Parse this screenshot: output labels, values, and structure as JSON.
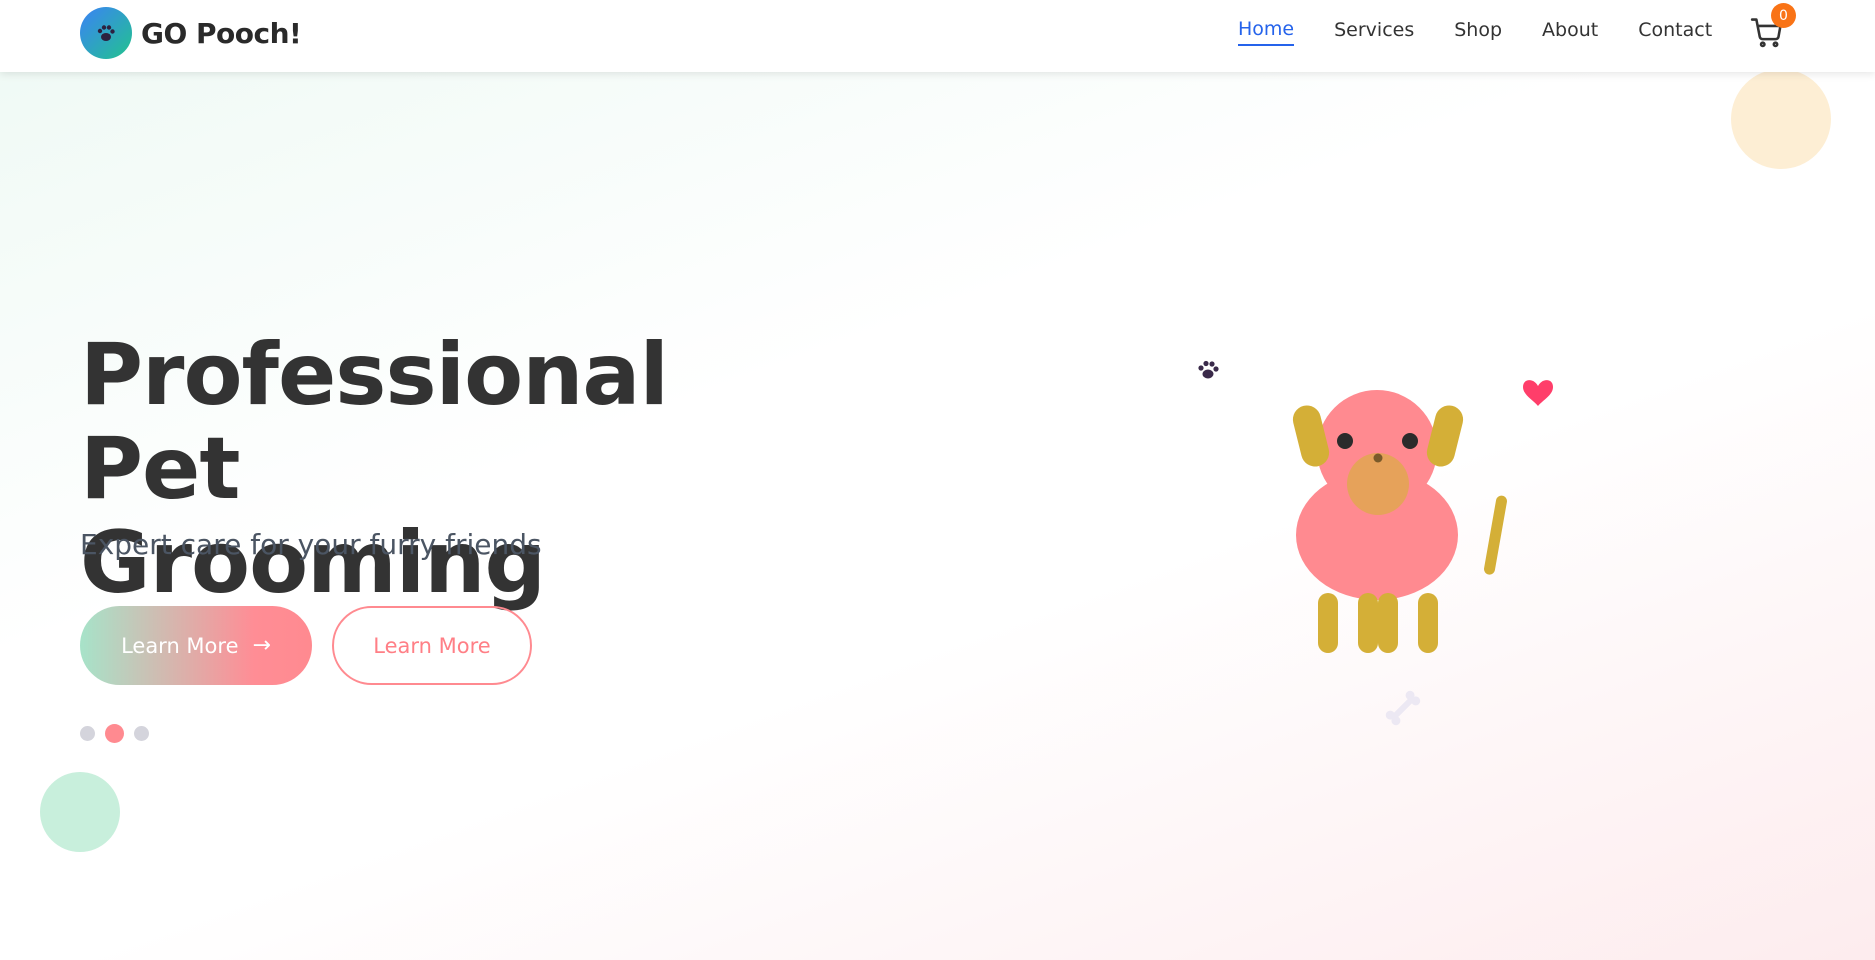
{
  "brand": {
    "name": "GO Pooch!",
    "logo_icon": "paw-icon"
  },
  "nav": {
    "items": [
      {
        "label": "Home",
        "active": true
      },
      {
        "label": "Services",
        "active": false
      },
      {
        "label": "Shop",
        "active": false
      },
      {
        "label": "About",
        "active": false
      },
      {
        "label": "Contact",
        "active": false
      }
    ],
    "cart_count": "0"
  },
  "hero": {
    "title_line1": "Professional Pet",
    "title_line2": "Grooming",
    "subtitle": "Expert care for your furry friends",
    "primary_button": "Learn More",
    "secondary_button": "Learn More",
    "slides": {
      "count": 3,
      "active_index": 1
    }
  },
  "colors": {
    "accent_blue": "#2563eb",
    "pink": "#ff8a90",
    "mint": "#a7e3c9",
    "badge_orange": "#f97316",
    "dog_body": "#ff8a90",
    "dog_ears_legs": "#d4af37"
  }
}
